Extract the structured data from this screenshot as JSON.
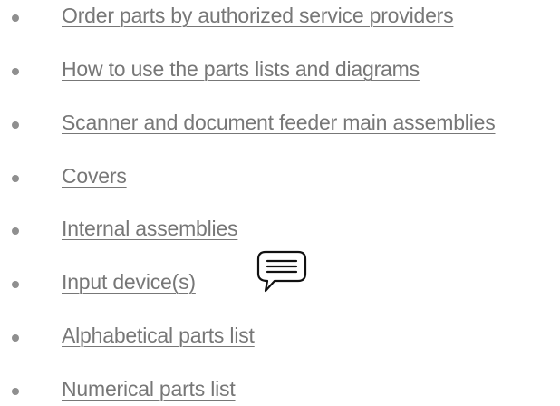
{
  "nav": {
    "items": [
      {
        "label": "Order parts by authorized service providers"
      },
      {
        "label": "How to use the parts lists and diagrams"
      },
      {
        "label": "Scanner and document feeder main assemblies"
      },
      {
        "label": "Covers"
      },
      {
        "label": "Internal assemblies"
      },
      {
        "label": "Input device(s)"
      },
      {
        "label": "Alphabetical parts list"
      },
      {
        "label": "Numerical parts list"
      }
    ]
  },
  "icons": {
    "comment": "comment-icon"
  },
  "colors": {
    "link": "#777777",
    "bullet": "#8f8f8f"
  }
}
